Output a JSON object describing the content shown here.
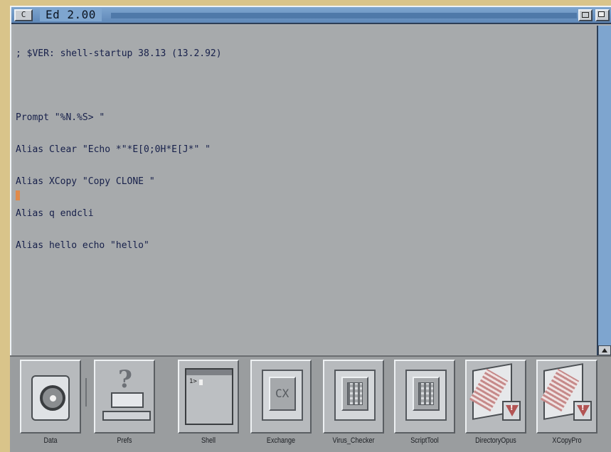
{
  "window": {
    "close_label": "C",
    "title": "Ed 2.00"
  },
  "editor": {
    "lines": [
      "; $VER: shell-startup 38.13 (13.2.92)",
      "",
      "Prompt \"%N.%S> \"",
      "Alias Clear \"Echo *\"*E[0;0H*E[J*\" \"",
      "Alias XCopy \"Copy CLONE \"",
      "Alias q endcli",
      "Alias hello echo \"hello\""
    ]
  },
  "dock": {
    "items": [
      {
        "label": "Data",
        "icon": "hard-disk-icon"
      },
      {
        "label": "Prefs",
        "icon": "prefs-icon"
      },
      {
        "label": "Shell",
        "icon": "shell-icon"
      },
      {
        "label": "Exchange",
        "icon": "exchange-icon"
      },
      {
        "label": "Virus_Checker",
        "icon": "virus-checker-icon"
      },
      {
        "label": "ScriptTool",
        "icon": "script-tool-icon"
      },
      {
        "label": "DirectoryOpus",
        "icon": "directory-opus-icon"
      },
      {
        "label": "XCopyPro",
        "icon": "xcopypro-icon"
      }
    ]
  },
  "colors": {
    "titlebar": "#7ea5cf",
    "editor_bg": "#a7aaac",
    "text": "#17204a",
    "cursor": "#e08a4a",
    "desktop": "#d9c48a"
  }
}
